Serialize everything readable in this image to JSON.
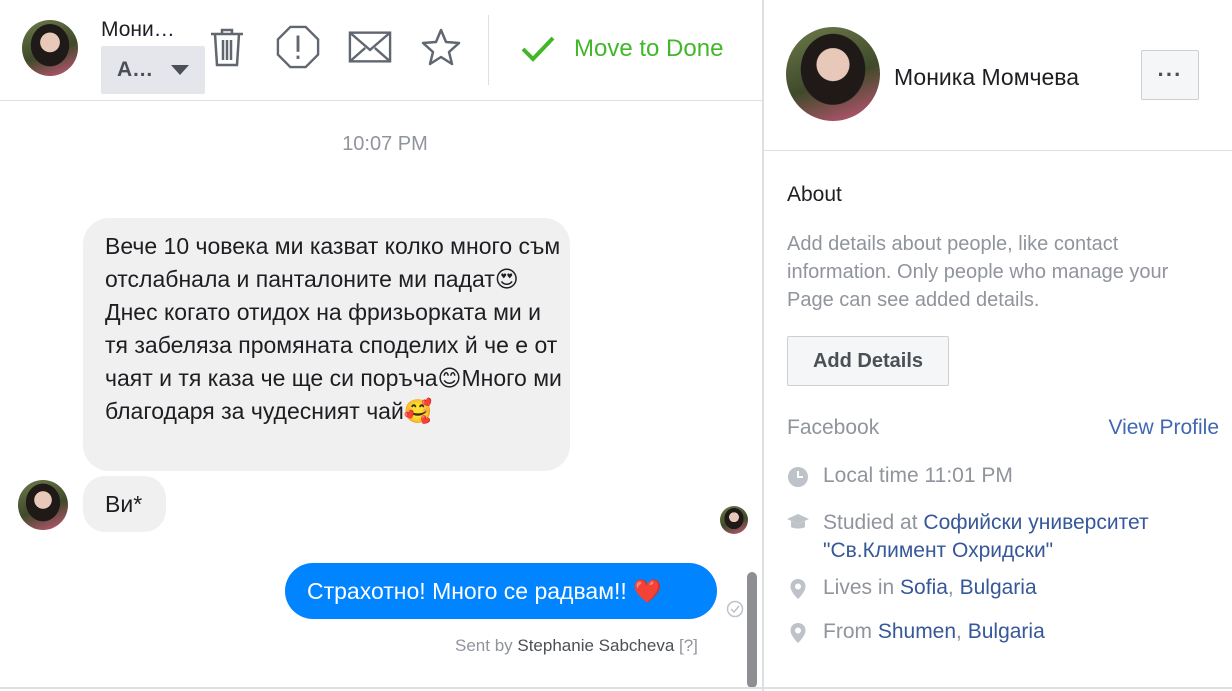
{
  "header": {
    "contact_name": "Мони…",
    "assign_label": "A…",
    "move_to_done": "Move to Done"
  },
  "chat": {
    "timestamp": "10:07 PM",
    "messages_in": [
      "Вече 10 човека ми казват колко много съм отслабнала и панталоните ми падат😍 Днес когато отидох на фризьорката ми и тя забеляза промяната споделих й че е от чаят и тя каза че ще си поръча😊Много ми благодаря за чудесният чай🥰",
      "Ви*"
    ],
    "message_out": "Страхотно! Много се радвам!! ❤️",
    "sent_by_prefix": "Sent by ",
    "sent_by_name": "Stephanie Sabcheva",
    "sent_by_help": " [?]"
  },
  "profile": {
    "name": "Моника Момчева",
    "more_label": "···",
    "about_title": "About",
    "about_desc": "Add details about people, like contact information. Only people who manage your Page can see added details.",
    "add_details": "Add Details",
    "facebook_label": "Facebook",
    "view_profile": "View Profile",
    "local_time": "Local time 11:01 PM",
    "studied_prefix": "Studied at ",
    "studied_school": "Софийски университет \"Св.Климент Охридски\"",
    "lives_prefix": "Lives in ",
    "lives_city": "Sofia",
    "lives_sep": ", ",
    "lives_country": "Bulgaria",
    "from_prefix": "From ",
    "from_city": "Shumen",
    "from_sep": ", ",
    "from_country": "Bulgaria"
  },
  "colors": {
    "accent_green": "#42b72a",
    "outgoing_bubble": "#0084ff",
    "link": "#365899"
  }
}
